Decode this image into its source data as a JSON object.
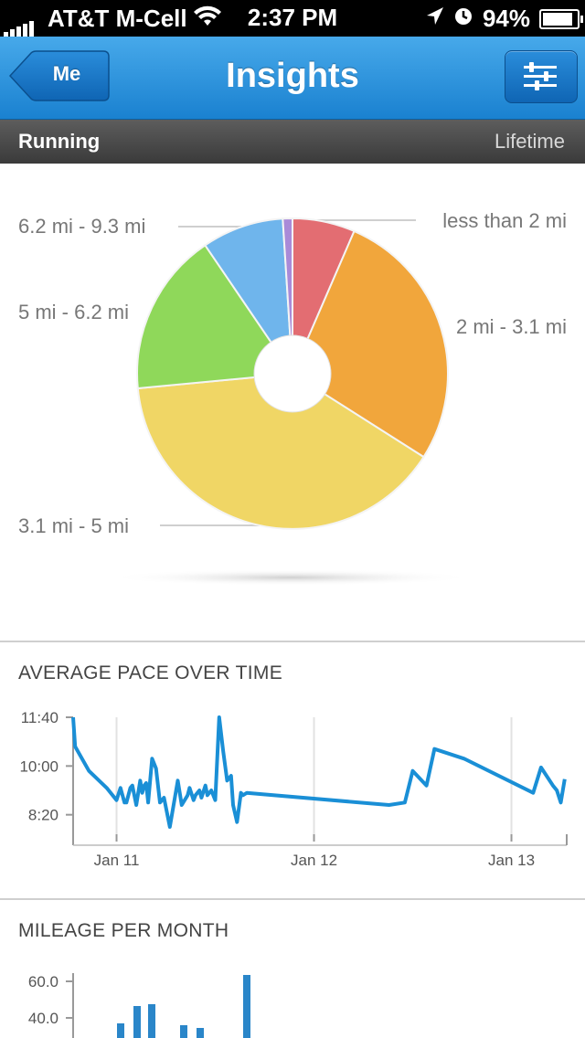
{
  "status_bar": {
    "carrier": "AT&T M-Cell",
    "time": "2:37 PM",
    "battery": "94%",
    "battery_level": 0.94,
    "icons": [
      "signal-icon",
      "wifi-icon",
      "location-arrow-icon",
      "clock-icon",
      "battery-icon"
    ]
  },
  "nav": {
    "back_label": "Me",
    "title": "Insights",
    "filter_icon": "sliders-icon"
  },
  "subbar": {
    "activity": "Running",
    "period": "Lifetime"
  },
  "colors": {
    "nav_blue": "#2f95e0",
    "line_blue": "#1a8fd6",
    "bar_blue": "#2a86c9"
  },
  "distance_chart": {
    "type": "pie",
    "labels": [
      "less than 2 mi",
      "2 mi - 3.1 mi",
      "3.1 mi - 5 mi",
      "5 mi - 6.2 mi",
      "6.2 mi - 9.3 mi"
    ],
    "slices": [
      {
        "label": "less than 2 mi",
        "value": 6.5,
        "color": "#e36d72"
      },
      {
        "label": "2 mi - 3.1 mi",
        "value": 27.5,
        "color": "#f1a63c"
      },
      {
        "label": "3.1 mi - 5 mi",
        "value": 39.5,
        "color": "#f0d665"
      },
      {
        "label": "5 mi - 6.2 mi",
        "value": 17,
        "color": "#8fd85a"
      },
      {
        "label": "6.2 mi - 9.3 mi",
        "value": 8.5,
        "color": "#6fb5ec"
      },
      {
        "label": "",
        "value": 1,
        "color": "#a98ad8"
      }
    ]
  },
  "pace_chart": {
    "title": "AVERAGE PACE OVER TIME",
    "type": "line",
    "y_ticks": [
      "11:40",
      "10:00",
      "8:20"
    ],
    "y_tick_values": [
      700,
      600,
      500
    ],
    "ylim": [
      460,
      700
    ],
    "x_ticks": [
      "Jan 11",
      "Jan 12",
      "Jan 13"
    ],
    "x_tick_values": [
      11,
      12,
      13
    ],
    "xlim": [
      10.78,
      13.28
    ],
    "grid": true,
    "series": [
      {
        "x": [
          10.78,
          10.79,
          10.86,
          10.95,
          11.0,
          11.02,
          11.04,
          11.05,
          11.07,
          11.08,
          11.1,
          11.12,
          11.13,
          11.14,
          11.15,
          11.16,
          11.18,
          11.19,
          11.2,
          11.22,
          11.24,
          11.27,
          11.31,
          11.33,
          11.36,
          11.37,
          11.39,
          11.4,
          11.42,
          11.43,
          11.45,
          11.46,
          11.48,
          11.5,
          11.52,
          11.54,
          11.56,
          11.58,
          11.59,
          11.61,
          11.63,
          11.64,
          11.66,
          11.74,
          12.38,
          12.46,
          12.5,
          12.57,
          12.61,
          12.76,
          13.11,
          13.15,
          13.21,
          13.23,
          13.25,
          13.27
        ],
        "y": [
          700,
          640,
          590,
          555,
          530,
          555,
          525,
          525,
          555,
          560,
          520,
          570,
          545,
          560,
          565,
          525,
          615,
          605,
          595,
          525,
          535,
          475,
          570,
          520,
          540,
          555,
          530,
          540,
          550,
          535,
          560,
          540,
          550,
          530,
          700,
          630,
          570,
          580,
          520,
          485,
          545,
          540,
          545,
          542,
          520,
          525,
          590,
          560,
          635,
          615,
          545,
          597,
          560,
          550,
          525,
          573
        ]
      }
    ]
  },
  "mileage_chart": {
    "title": "MILEAGE PER MONTH",
    "type": "bar",
    "y_ticks": [
      "60.0",
      "40.0"
    ],
    "y_tick_values": [
      60,
      40
    ],
    "ylim": [
      20,
      65
    ],
    "bars": [
      {
        "value": 37
      },
      {
        "value": 46.5
      },
      {
        "value": 47.5
      },
      {
        "value": 36
      },
      {
        "value": 34.5
      },
      {
        "value": 63.5
      }
    ]
  }
}
